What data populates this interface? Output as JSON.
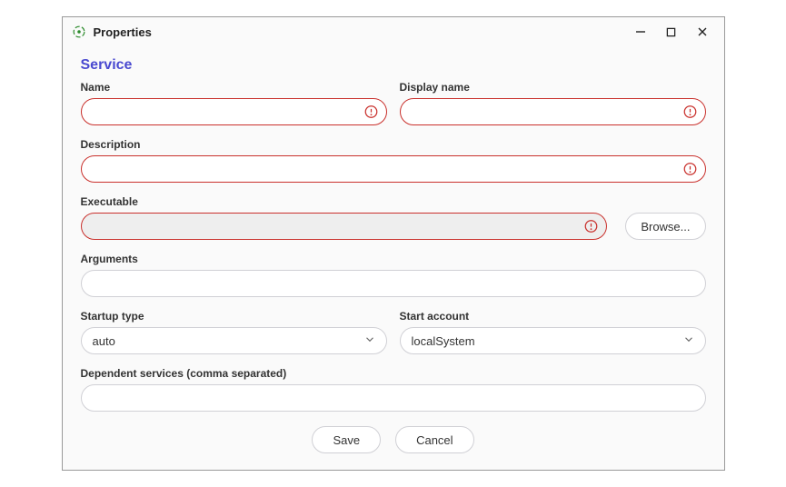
{
  "window": {
    "title": "Properties"
  },
  "section": {
    "title": "Service"
  },
  "fields": {
    "name": {
      "label": "Name",
      "value": "",
      "error": true
    },
    "displayName": {
      "label": "Display name",
      "value": "",
      "error": true
    },
    "description": {
      "label": "Description",
      "value": "",
      "error": true
    },
    "executable": {
      "label": "Executable",
      "value": "",
      "error": true,
      "browseLabel": "Browse..."
    },
    "arguments": {
      "label": "Arguments",
      "value": ""
    },
    "startupType": {
      "label": "Startup type",
      "value": "auto"
    },
    "startAccount": {
      "label": "Start account",
      "value": "localSystem"
    },
    "dependentServices": {
      "label": "Dependent services (comma separated)",
      "value": ""
    }
  },
  "actions": {
    "save": "Save",
    "cancel": "Cancel"
  }
}
